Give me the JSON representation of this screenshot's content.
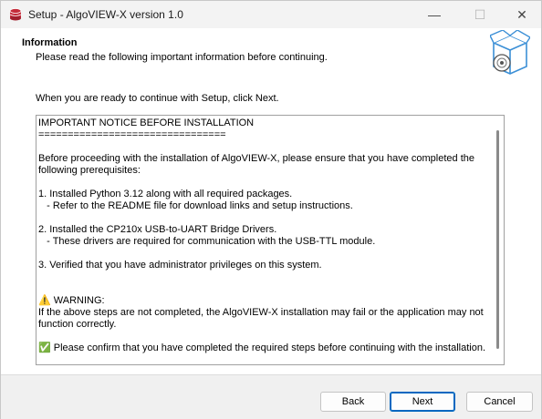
{
  "window": {
    "title": "Setup - AlgoVIEW-X version 1.0",
    "controls": {
      "minimize": "—",
      "maximize": "☐",
      "close": "✕"
    }
  },
  "header": {
    "title": "Information",
    "subtitle": "Please read the following important information before continuing."
  },
  "content": {
    "intro": "When you are ready to continue with Setup, click Next.",
    "memo_lines": [
      "IMPORTANT NOTICE BEFORE INSTALLATION",
      "================================",
      "",
      "Before proceeding with the installation of AlgoVIEW-X, please ensure that you have completed the",
      "following prerequisites:",
      "",
      "1. Installed Python 3.12 along with all required packages.",
      "   - Refer to the README file for download links and setup instructions.",
      "",
      "2. Installed the CP210x USB-to-UART Bridge Drivers.",
      "   - These drivers are required for communication with the USB-TTL module.",
      "",
      "3. Verified that you have administrator privileges on this system.",
      "",
      "",
      "⚠️ WARNING:",
      "If the above steps are not completed, the AlgoVIEW-X installation may fail or the application may not",
      "function correctly.",
      "",
      "✅ Please confirm that you have completed the required steps before continuing with the installation."
    ]
  },
  "buttons": {
    "back": "Back",
    "next": "Next",
    "cancel": "Cancel"
  },
  "colors": {
    "accent": "#0067c0",
    "app_icon": "#c42b3a"
  }
}
